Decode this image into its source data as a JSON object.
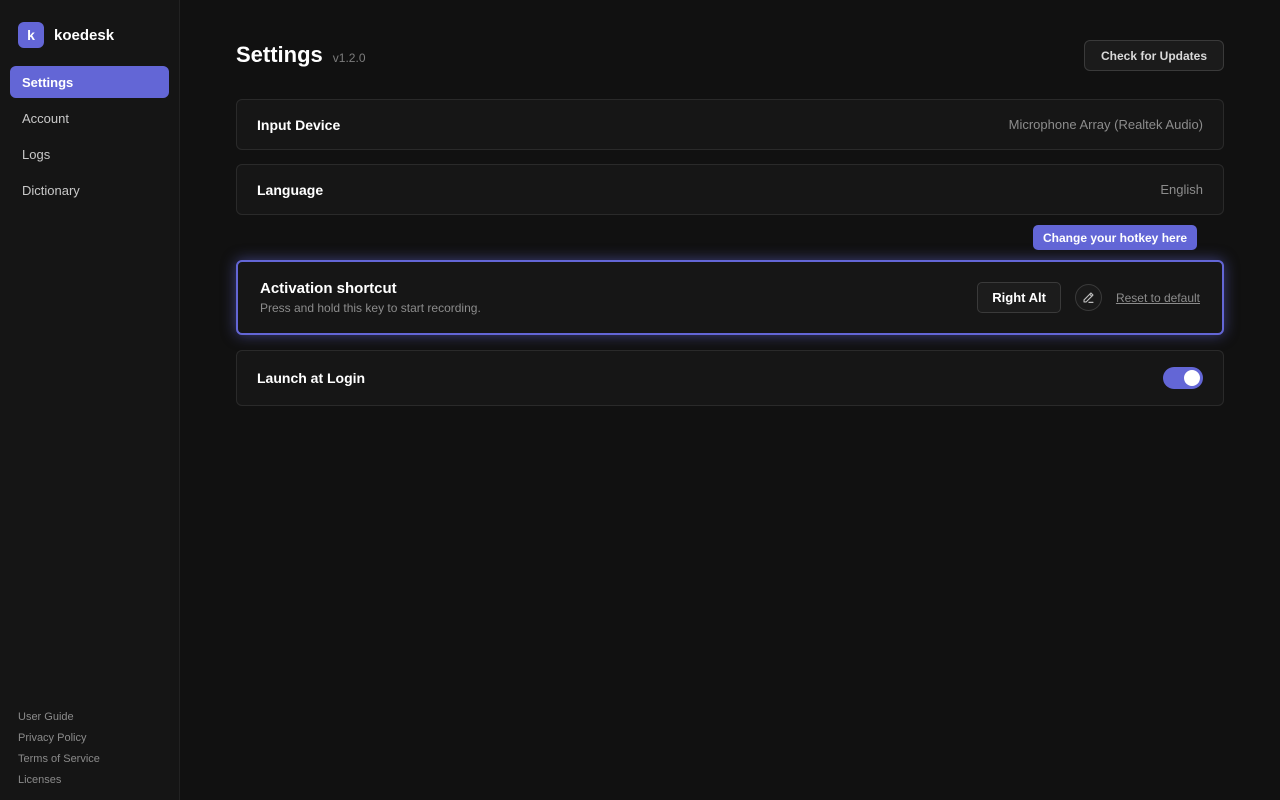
{
  "brand": {
    "logo_letter": "k",
    "name": "koedesk"
  },
  "sidebar": {
    "items": [
      {
        "label": "Settings",
        "active": true
      },
      {
        "label": "Account",
        "active": false
      },
      {
        "label": "Logs",
        "active": false
      },
      {
        "label": "Dictionary",
        "active": false
      }
    ],
    "footer_links": [
      {
        "label": "User Guide"
      },
      {
        "label": "Privacy Policy"
      },
      {
        "label": "Terms of Service"
      },
      {
        "label": "Licenses"
      }
    ]
  },
  "header": {
    "title": "Settings",
    "version": "v1.2.0",
    "update_label": "Check for Updates"
  },
  "settings": {
    "input_device": {
      "label": "Input Device",
      "value": "Microphone Array (Realtek Audio)"
    },
    "language": {
      "label": "Language",
      "value": "English"
    },
    "hint": "Change your hotkey here",
    "shortcut": {
      "title": "Activation shortcut",
      "description": "Press and hold this key to start recording.",
      "key": "Right Alt",
      "reset_label": "Reset to default"
    },
    "launch_at_login": {
      "label": "Launch at Login",
      "enabled": true
    }
  },
  "colors": {
    "accent": "#6366d6",
    "background": "#111111",
    "sidebar": "#151515",
    "card": "#161616"
  },
  "icons": {
    "edit": "pencil-icon"
  }
}
